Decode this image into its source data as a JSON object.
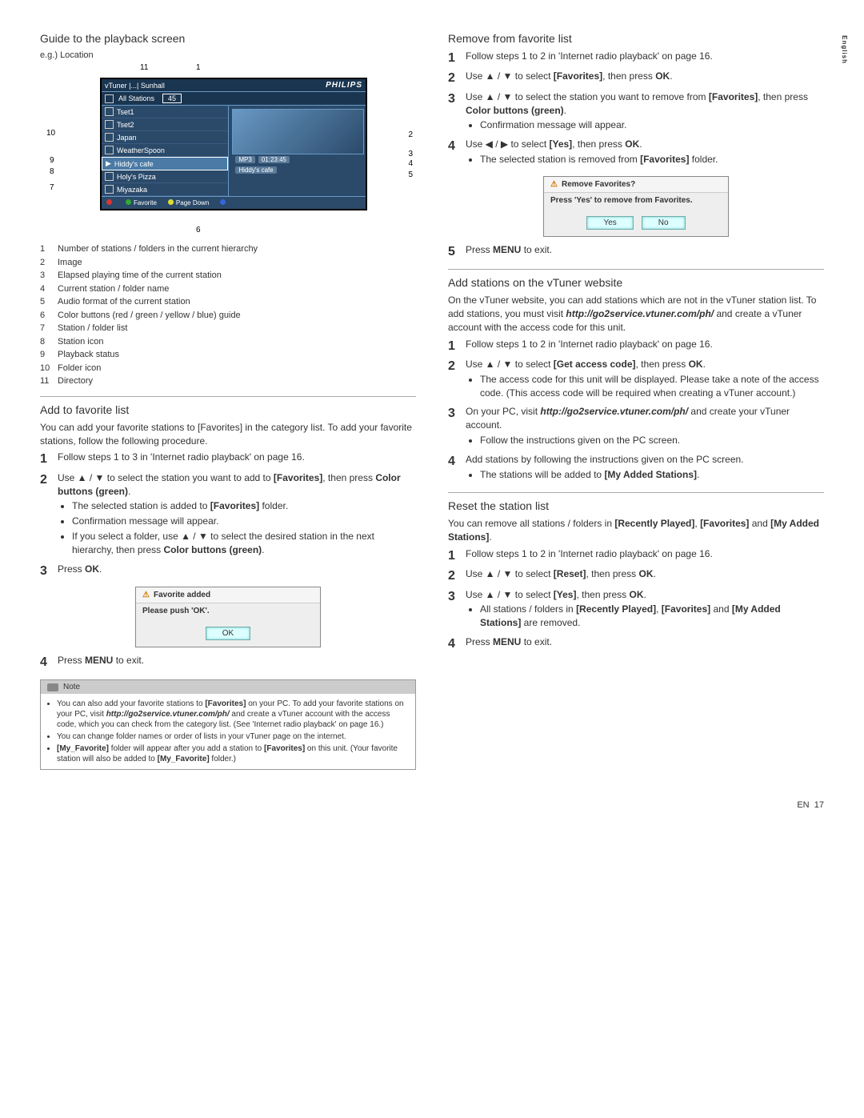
{
  "side_tab": "English",
  "footer": {
    "lang": "EN",
    "page": "17"
  },
  "left": {
    "h_guide": "Guide to the playback screen",
    "eg": "e.g.) Location",
    "screen": {
      "breadcrumb": "vTuner |...| Sunhall",
      "logo": "PHILIPS",
      "all_stations": "All Stations",
      "count": "45",
      "items": [
        "Tset1",
        "Tset2",
        "Japan",
        "WeatherSpoon",
        "Hiddy's cafe",
        "Holy's Pizza",
        "Miyazaka"
      ],
      "now_tag1": "MP3",
      "now_tag2": "01:23:45",
      "now_name": "Hiddy's cafe",
      "foot_fav": "Favorite",
      "foot_pd": "Page Down"
    },
    "callouts": {
      "1": "1",
      "2": "2",
      "3": "3",
      "4": "4",
      "5": "5",
      "6": "6",
      "7": "7",
      "8": "8",
      "9": "9",
      "10": "10",
      "11": "11"
    },
    "legend": [
      {
        "n": "1",
        "t": "Number of stations / folders in the current hierarchy"
      },
      {
        "n": "2",
        "t": "Image"
      },
      {
        "n": "3",
        "t": "Elapsed playing time of the current station"
      },
      {
        "n": "4",
        "t": "Current station / folder name"
      },
      {
        "n": "5",
        "t": "Audio format of the current station"
      },
      {
        "n": "6",
        "t": "Color buttons (red / green / yellow / blue) guide"
      },
      {
        "n": "7",
        "t": "Station / folder list"
      },
      {
        "n": "8",
        "t": "Station icon"
      },
      {
        "n": "9",
        "t": "Playback status"
      },
      {
        "n": "10",
        "t": "Folder icon"
      },
      {
        "n": "11",
        "t": "Directory"
      }
    ],
    "h_addfav": "Add to favorite list",
    "addfav_intro": "You can add your favorite stations to [Favorites] in the category list. To add your favorite stations, follow the following procedure.",
    "addfav_steps": {
      "1": "Follow steps 1 to 3 in 'Internet radio playback' on page 16.",
      "2a": "Use ▲ / ▼ to select the station you want to add to ",
      "2b": "[Favorites]",
      "2c": ", then press ",
      "2d": "Color buttons (green)",
      "2e": ".",
      "2sub1a": "The selected station is added to ",
      "2sub1b": "[Favorites]",
      "2sub1c": " folder.",
      "2sub2": "Confirmation message will appear.",
      "2sub3a": "If you select a folder, use ▲ / ▼ to select the desired station in the next hierarchy, then press ",
      "2sub3b": "Color buttons (green)",
      "2sub3c": ".",
      "3a": "Press ",
      "3b": "OK",
      "3c": ".",
      "4a": "Press ",
      "4b": "MENU",
      "4c": " to exit."
    },
    "dialog1": {
      "title": "Favorite added",
      "body": "Please push 'OK'.",
      "btn": "OK"
    },
    "note_label": "Note",
    "notes": {
      "1a": "You can also add your favorite stations to ",
      "1b": "[Favorites]",
      "1c": " on your PC. To add your favorite stations on your PC, visit ",
      "1d": "http://go2service.vtuner.com/ph/",
      "1e": " and create a vTuner account with the access code, which you can check from the category list. (See 'Internet radio playback' on page 16.)",
      "2": "You can change folder names or order of lists in your vTuner page on the internet.",
      "3a": "[My_Favorite]",
      "3b": " folder will appear after you add a station to ",
      "3c": "[Favorites]",
      "3d": " on this unit. (Your favorite station will also be added to ",
      "3e": "[My_Favorite]",
      "3f": " folder.)"
    }
  },
  "right": {
    "h_remove": "Remove from favorite list",
    "remove": {
      "1": "Follow steps 1 to 2 in 'Internet radio playback' on page 16.",
      "2a": "Use ▲ / ▼ to select ",
      "2b": "[Favorites]",
      "2c": ", then press ",
      "2d": "OK",
      "2e": ".",
      "3a": "Use ▲ / ▼ to select the station you want to remove from ",
      "3b": "[Favorites]",
      "3c": ", then press ",
      "3d": "Color buttons (green)",
      "3e": ".",
      "3sub": "Confirmation message will appear.",
      "4a": "Use ◀ / ▶ to select ",
      "4b": "[Yes]",
      "4c": ", then press ",
      "4d": "OK",
      "4e": ".",
      "4sub_a": "The selected station is removed from ",
      "4sub_b": "[Favorites]",
      "4sub_c": " folder.",
      "5a": "Press ",
      "5b": "MENU",
      "5c": " to exit."
    },
    "dialog2": {
      "title": "Remove Favorites?",
      "body": "Press 'Yes' to remove from Favorites.",
      "yes": "Yes",
      "no": "No"
    },
    "h_vtuner": "Add stations on the vTuner website",
    "vtuner_intro_a": "On the vTuner website, you can add stations which are not in the vTuner station list. To add stations, you must visit ",
    "vtuner_intro_b": "http://go2service.vtuner.com/ph/",
    "vtuner_intro_c": " and create a vTuner account with the access code for this unit.",
    "vtuner": {
      "1": "Follow steps 1 to 2 in 'Internet radio playback' on page 16.",
      "2a": "Use ▲ / ▼ to select ",
      "2b": "[Get access code]",
      "2c": ", then press ",
      "2d": "OK",
      "2e": ".",
      "2sub": "The access code for this unit will be displayed. Please take a note of the access code. (This access code will be required when creating a vTuner account.)",
      "3a": "On your PC, visit ",
      "3b": "http://go2service.vtuner.com/ph/",
      "3c": " and create your vTuner account.",
      "3sub": "Follow the instructions given on the PC screen.",
      "4": "Add stations by following the instructions given on the PC screen.",
      "4sub_a": "The stations will be added to ",
      "4sub_b": "[My Added Stations]",
      "4sub_c": "."
    },
    "h_reset": "Reset the station list",
    "reset_intro_a": "You can remove all stations / folders in ",
    "reset_intro_b": "[Recently Played]",
    "reset_intro_c": ", ",
    "reset_intro_d": "[Favorites]",
    "reset_intro_e": " and ",
    "reset_intro_f": "[My Added Stations]",
    "reset_intro_g": ".",
    "reset": {
      "1": "Follow steps 1 to 2 in 'Internet radio playback' on page 16.",
      "2a": "Use ▲ / ▼ to select ",
      "2b": "[Reset]",
      "2c": ", then press ",
      "2d": "OK",
      "2e": ".",
      "3a": "Use ▲ / ▼ to select ",
      "3b": "[Yes]",
      "3c": ", then press ",
      "3d": "OK",
      "3e": ".",
      "3sub_a": "All stations / folders in ",
      "3sub_b": "[Recently Played]",
      "3sub_c": ", ",
      "3sub_d": "[Favorites]",
      "3sub_e": "  and ",
      "3sub_f": "[My Added Stations]",
      "3sub_g": " are removed.",
      "4a": "Press ",
      "4b": "MENU",
      "4c": " to exit."
    }
  }
}
